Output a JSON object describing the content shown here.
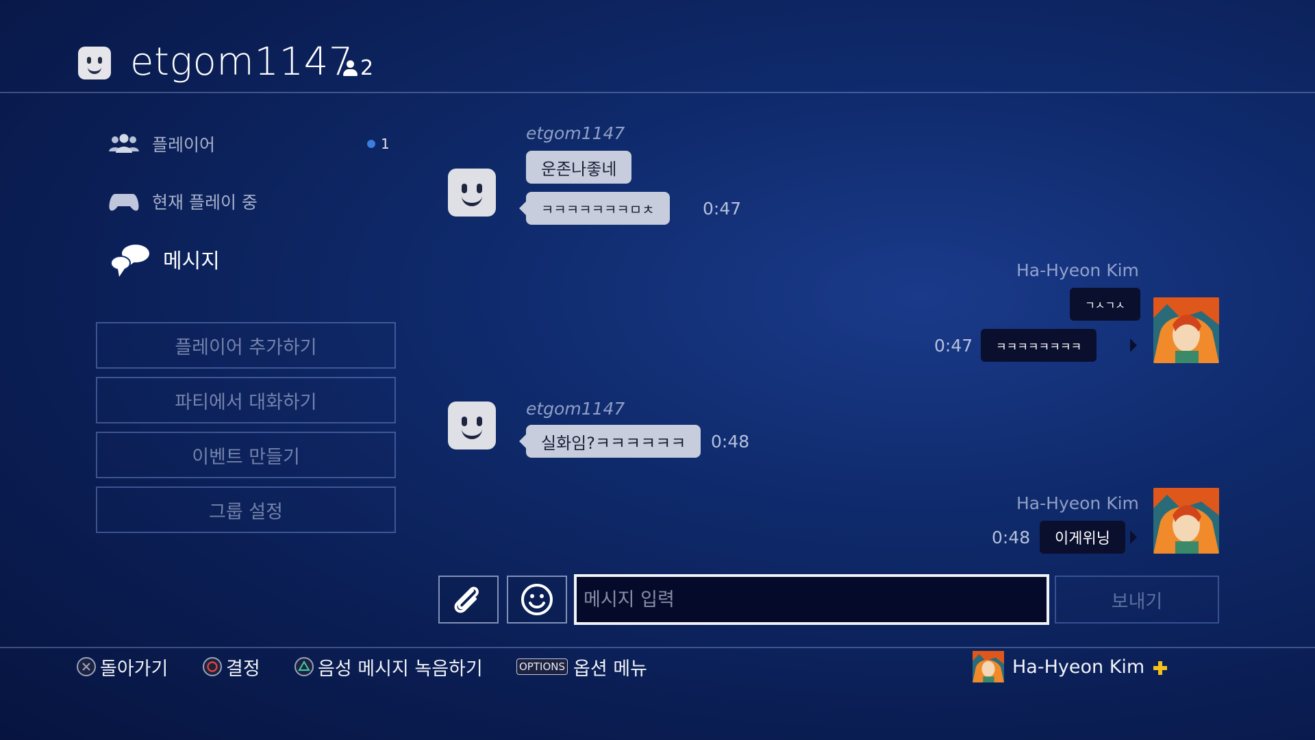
{
  "header": {
    "title": "etgom1147",
    "member_count": "2"
  },
  "sidebar": {
    "nav": [
      {
        "label": "플레이어",
        "badge": "1"
      },
      {
        "label": "현재 플레이 중"
      },
      {
        "label": "메시지"
      }
    ],
    "buttons": [
      "플레이어 추가하기",
      "파티에서 대화하기",
      "이벤트 만들기",
      "그룹 설정"
    ]
  },
  "chat": {
    "messages": [
      {
        "sender": "etgom1147",
        "lines": [
          "운존나좋네",
          "ㅋㅋㅋㅋㅋㅋㅋㅁㅊ"
        ],
        "time": "0:47",
        "side": "left"
      },
      {
        "sender": "Ha-Hyeon Kim",
        "lines": [
          "ㄱㅅㄱㅅ",
          "ㅋㅋㅋㅋㅋㅋㅋㅋ"
        ],
        "time": "0:47",
        "side": "right"
      },
      {
        "sender": "etgom1147",
        "lines": [
          "실화임?ㅋㅋㅋㅋㅋㅋ"
        ],
        "time": "0:48",
        "side": "left"
      },
      {
        "sender": "Ha-Hyeon Kim",
        "lines": [
          "이게위닝"
        ],
        "time": "0:48",
        "side": "right"
      }
    ]
  },
  "composer": {
    "placeholder": "메시지 입력",
    "send_label": "보내기"
  },
  "footer": {
    "back": "돌아가기",
    "confirm": "결정",
    "voice": "음성 메시지 녹음하기",
    "options_tag": "OPTIONS",
    "options": "옵션 메뉴",
    "user": "Ha-Hyeon Kim"
  },
  "colors": {
    "accent_blue": "#3c7de0",
    "plus_yellow": "#f2c21b",
    "bubble_in": "#c7cddc",
    "bubble_out": "#0b0f2e"
  }
}
